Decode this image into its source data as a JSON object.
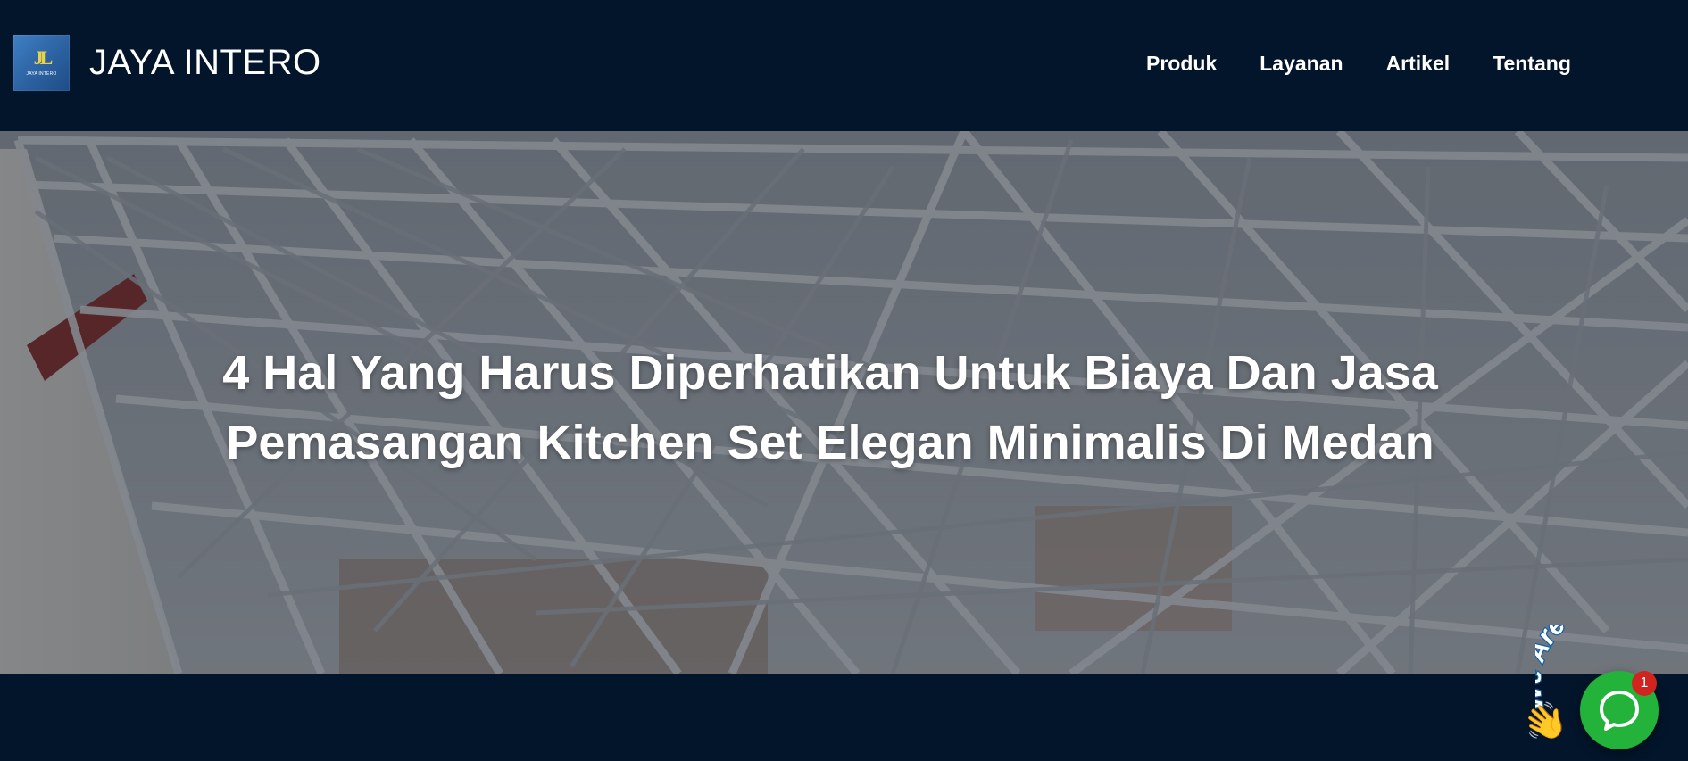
{
  "header": {
    "logo": {
      "mark": "JL",
      "subtitle": "JAYA INTERO"
    },
    "brand_name": "JAYA INTERO",
    "nav": [
      {
        "label": "Produk"
      },
      {
        "label": "Layanan"
      },
      {
        "label": "Artikel"
      },
      {
        "label": "Tentang"
      }
    ]
  },
  "hero": {
    "title_line1": "4 Hal Yang Harus Diperhatikan Untuk Biaya Dan Jasa",
    "title_line2": "Pemasangan Kitchen Set Elegan Minimalis Di Medan"
  },
  "chat_widget": {
    "tagline": "We Are Here!",
    "badge_count": "1",
    "icon": "chat-bubble-icon",
    "wave_icon": "waving-hand-icon",
    "color": "#23b33a"
  },
  "colors": {
    "background": "#03152a",
    "badge": "#d2231f"
  }
}
